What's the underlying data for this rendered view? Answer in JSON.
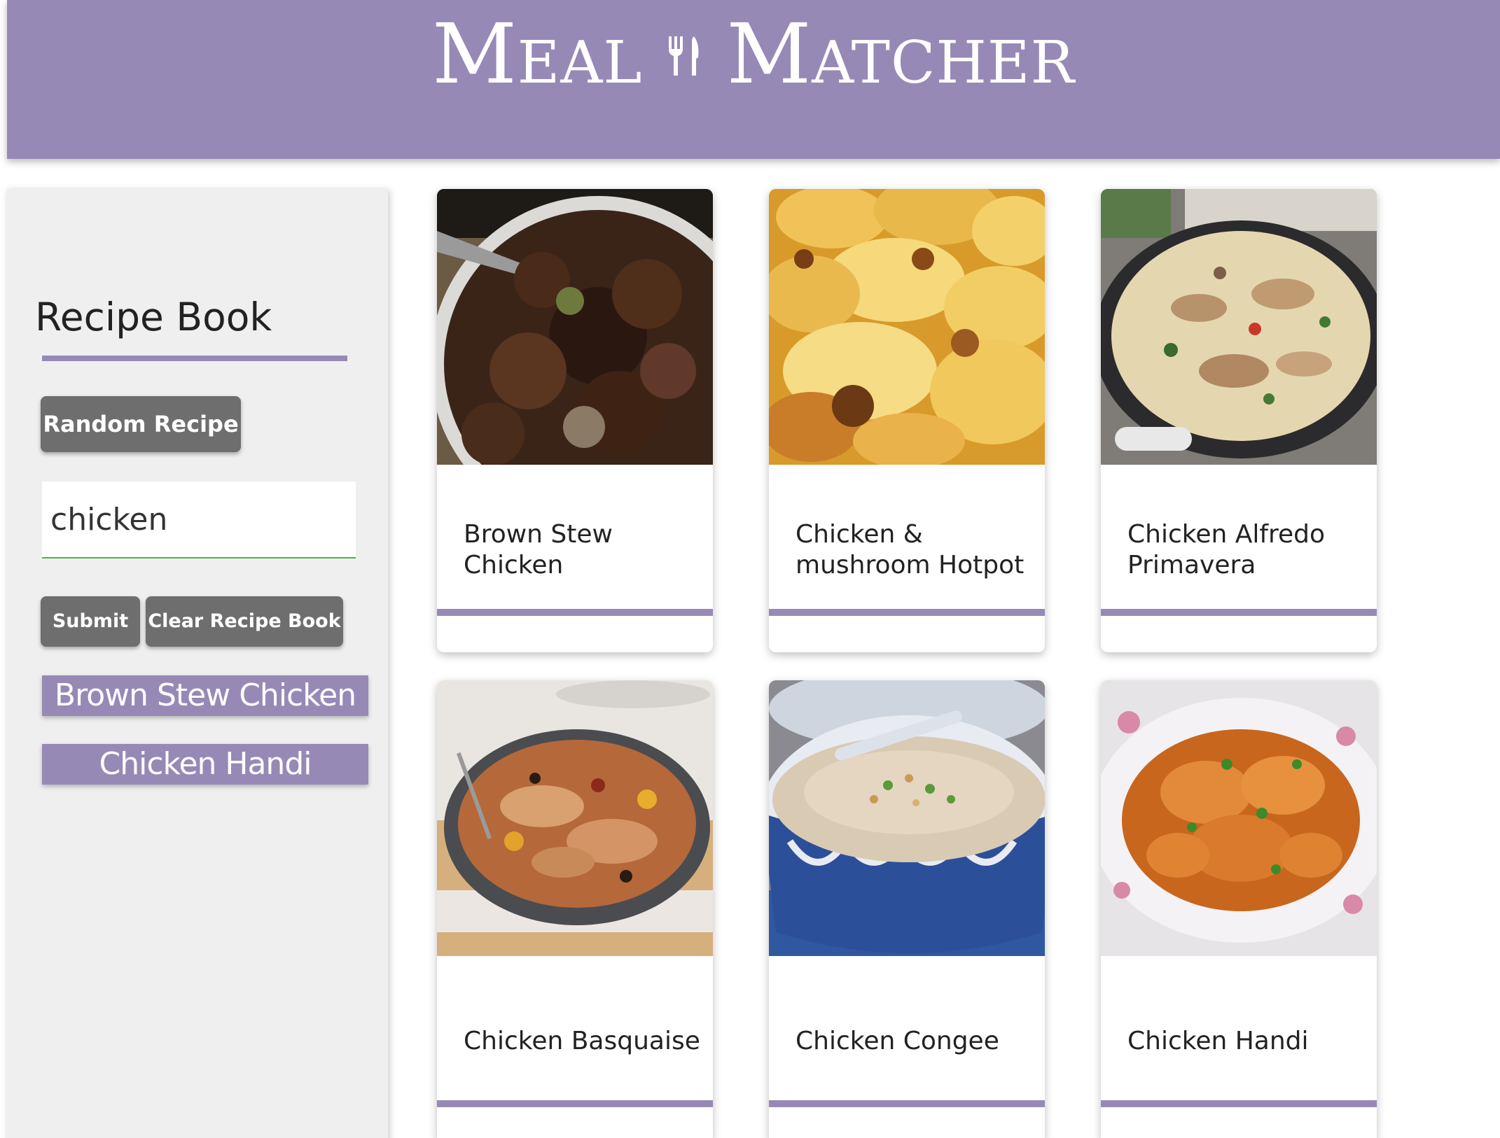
{
  "header": {
    "title_left": "Meal",
    "title_right": "Matcher",
    "logo_icon": "fork-knife-icon",
    "accent_color": "#9789b6"
  },
  "sidebar": {
    "title": "Recipe Book",
    "random_button_label": "Random Recipe",
    "search": {
      "value": "chicken",
      "placeholder": ""
    },
    "submit_label": "Submit",
    "clear_label": "Clear Recipe Book",
    "saved_recipes": [
      "Brown Stew Chicken",
      "Chicken Handi"
    ]
  },
  "results": {
    "cards": [
      {
        "title": "Brown Stew Chicken",
        "image": "braised-chicken-stew-photo"
      },
      {
        "title": "Chicken & mushroom Hotpot",
        "image": "potato-topped-hotpot-photo"
      },
      {
        "title": "Chicken Alfredo Primavera",
        "image": "chicken-farfalle-pan-photo"
      },
      {
        "title": "Chicken Basquaise",
        "image": "chicken-casserole-pan-photo"
      },
      {
        "title": "Chicken Congee",
        "image": "rice-congee-bowl-photo"
      },
      {
        "title": "Chicken Handi",
        "image": "chicken-curry-plate-photo"
      }
    ]
  }
}
